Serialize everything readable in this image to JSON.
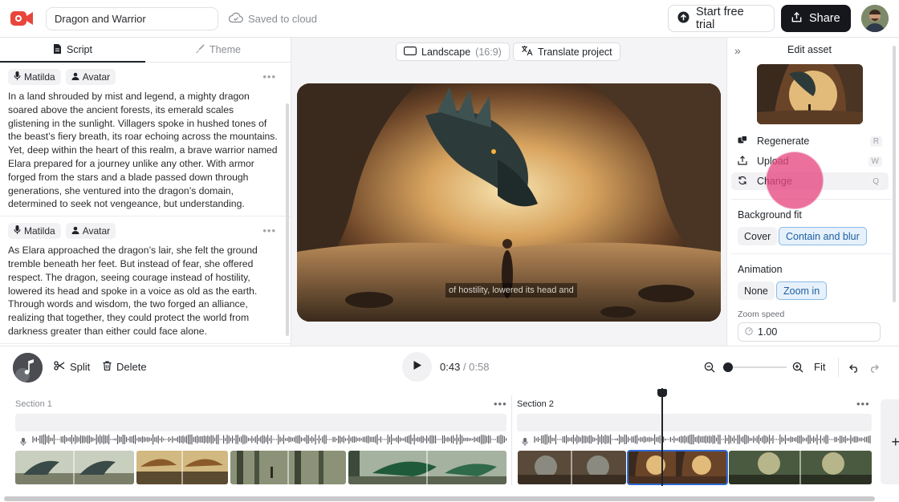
{
  "header": {
    "project_name": "Dragon and Warrior",
    "cloud_status": "Saved to cloud",
    "trial_label": "Start free trial",
    "share_label": "Share"
  },
  "script_panel": {
    "tabs": [
      {
        "label": "Script",
        "active": true
      },
      {
        "label": "Theme",
        "active": false
      }
    ],
    "blocks": [
      {
        "voice": "Matilda",
        "avatar": "Avatar",
        "text": "In a land shrouded by mist and legend, a mighty dragon soared above the ancient forests, its emerald scales glistening in the sunlight. Villagers spoke in hushed tones of the beast’s fiery breath, its roar echoing across the mountains. Yet, deep within the heart of this realm, a brave warrior named Elara prepared for a journey unlike any other. With armor forged from the stars and a blade passed down through generations, she ventured into the dragon’s domain, determined to seek not vengeance, but understanding."
      },
      {
        "voice": "Matilda",
        "avatar": "Avatar",
        "text": "As Elara approached the dragon’s lair, she felt the ground tremble beneath her feet. But instead of fear, she offered respect. The dragon, seeing courage instead of hostility, lowered its head and spoke in a voice as old as the earth. Through words and wisdom, the two forged an alliance, realizing that together, they could protect the world from darkness greater than either could face alone."
      }
    ]
  },
  "preview": {
    "aspect_label": "Landscape",
    "aspect_ratio": "(16:9)",
    "translate_label": "Translate project",
    "caption": "of hostility, lowered its head and"
  },
  "asset_panel": {
    "title": "Edit asset",
    "actions": [
      {
        "label": "Regenerate",
        "key": "R"
      },
      {
        "label": "Upload",
        "key": "W"
      },
      {
        "label": "Change",
        "key": "Q"
      }
    ],
    "background_fit": {
      "label": "Background fit",
      "options": [
        "Cover",
        "Contain and blur"
      ],
      "selected": "Contain and blur"
    },
    "animation": {
      "label": "Animation",
      "options": [
        "None",
        "Zoom in"
      ],
      "selected": "Zoom in"
    },
    "zoom_speed": {
      "label": "Zoom speed",
      "value": "1.00"
    }
  },
  "player": {
    "split_label": "Split",
    "delete_label": "Delete",
    "current_time": "0:43",
    "total_time": "/ 0:58",
    "fit_label": "Fit",
    "zoom_level": 0.05
  },
  "timeline": {
    "sections": [
      {
        "label": "Section 1"
      },
      {
        "label": "Section 2"
      }
    ],
    "add_label": "+",
    "colors": {
      "selection": "#2f6bd6",
      "playhead": "#1f2328"
    }
  }
}
